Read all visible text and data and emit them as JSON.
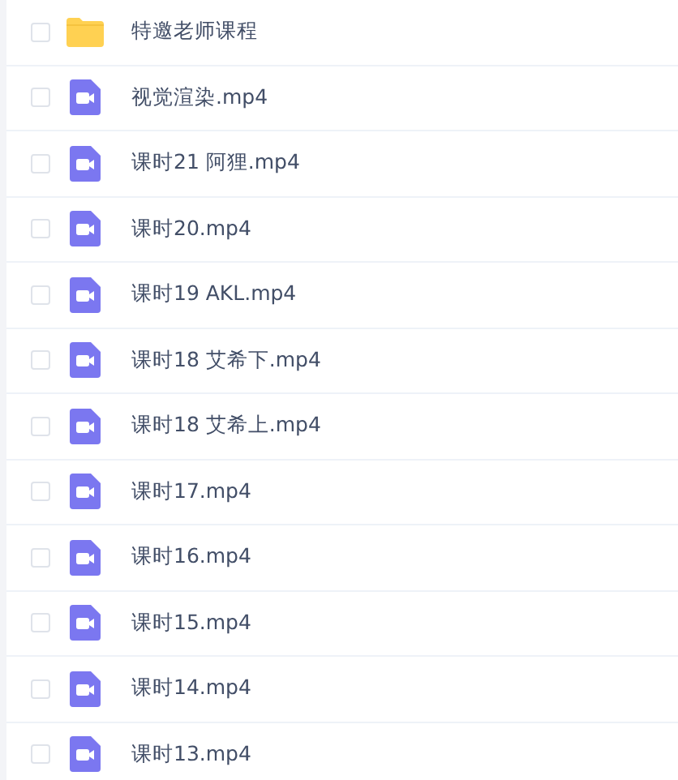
{
  "files": [
    {
      "kind": "folder",
      "name": "特邀老师课程",
      "checked": false
    },
    {
      "kind": "video",
      "name": "视觉渲染.mp4",
      "checked": false
    },
    {
      "kind": "video",
      "name": "课时21 阿狸.mp4",
      "checked": false
    },
    {
      "kind": "video",
      "name": "课时20.mp4",
      "checked": false
    },
    {
      "kind": "video",
      "name": "课时19 AKL.mp4",
      "checked": false
    },
    {
      "kind": "video",
      "name": "课时18 艾希下.mp4",
      "checked": false
    },
    {
      "kind": "video",
      "name": "课时18 艾希上.mp4",
      "checked": false
    },
    {
      "kind": "video",
      "name": "课时17.mp4",
      "checked": false
    },
    {
      "kind": "video",
      "name": "课时16.mp4",
      "checked": false
    },
    {
      "kind": "video",
      "name": "课时15.mp4",
      "checked": false
    },
    {
      "kind": "video",
      "name": "课时14.mp4",
      "checked": false
    },
    {
      "kind": "video",
      "name": "课时13.mp4",
      "checked": false
    }
  ]
}
